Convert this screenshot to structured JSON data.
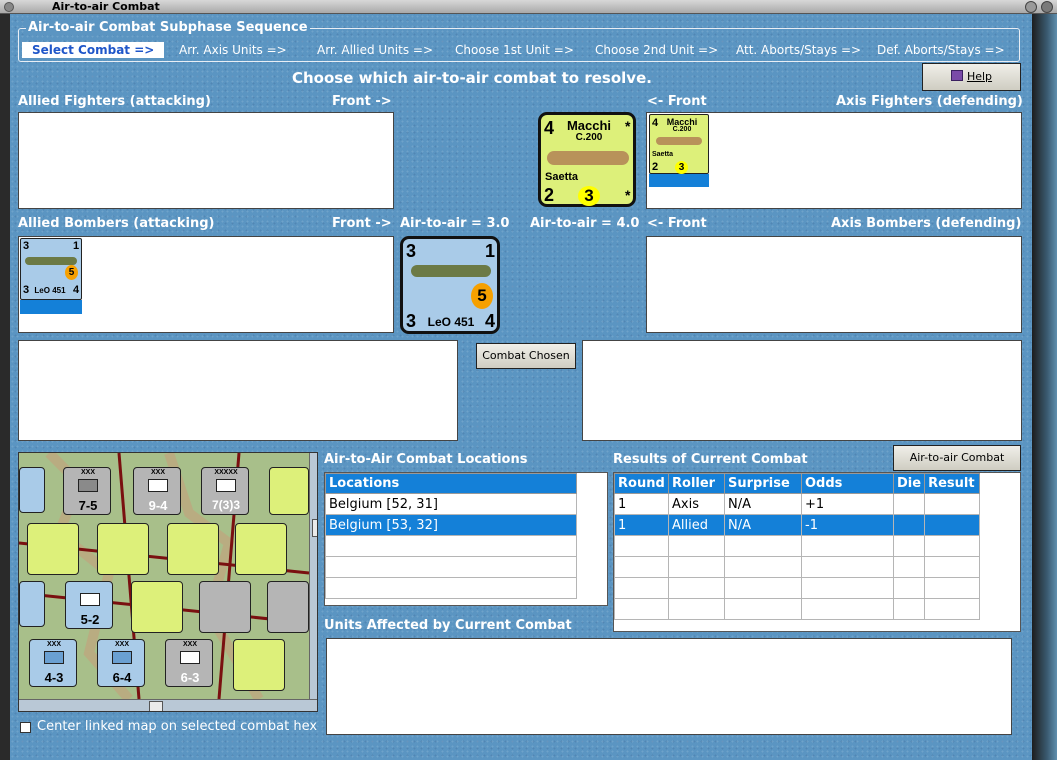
{
  "window": {
    "title": "Air-to-air Combat"
  },
  "sequence": {
    "title": "Air-to-air Combat Subphase Sequence",
    "steps": [
      "Select Combat =>",
      "Arr. Axis Units =>",
      "Arr. Allied Units =>",
      "Choose 1st Unit =>",
      "Choose 2nd Unit =>",
      "Att. Aborts/Stays =>",
      "Def. Aborts/Stays =>"
    ]
  },
  "instruction": "Choose which air-to-air combat to resolve.",
  "help_label": "Help",
  "headings": {
    "allied_fighters": "Allied Fighters (attacking)",
    "front_right_1": "Front ->",
    "front_left_1": "<- Front",
    "axis_fighters": "Axis Fighters (defending)",
    "allied_bombers": "Allied Bombers (attacking)",
    "front_right_2": "Front ->",
    "air_to_air_allied": "Air-to-air = 3.0",
    "air_to_air_axis": "Air-to-air = 4.0",
    "front_left_2": "<- Front",
    "axis_bombers": "Axis Bombers (defending)"
  },
  "combat_chosen_label": "Combat Chosen",
  "locations": {
    "title": "Air-to-Air Combat Locations",
    "header": "Locations",
    "rows": [
      "Belgium [52, 31]",
      "Belgium [53, 32]"
    ],
    "selected_index": 1
  },
  "results": {
    "title": "Results of Current Combat",
    "chart_button": "Air-to-air Combat Chart",
    "headers": [
      "Round",
      "Roller",
      "Surprise",
      "Odds",
      "Die",
      "Result"
    ],
    "rows": [
      [
        "1",
        "Axis",
        "N/A",
        "+1",
        "",
        ""
      ],
      [
        "1",
        "Allied",
        "N/A",
        "-1",
        "",
        ""
      ]
    ],
    "selected_index": 1
  },
  "units_affected_title": "Units Affected by Current Combat",
  "center_map_label": "Center linked map on selected combat hex",
  "units": {
    "macchi": {
      "top_left": "4",
      "name": "Macchi",
      "model": "C.200",
      "star": "*",
      "nickname": "Saetta",
      "bottom_left": "2",
      "value": "3"
    },
    "leo": {
      "top_left": "3",
      "top_right": "1",
      "value": "5",
      "bottom_left": "3",
      "name": "LeO 451",
      "bottom_right": "4"
    }
  },
  "map_counters": [
    {
      "label": "7-5",
      "top": "XXX"
    },
    {
      "label": "9-4",
      "top": "XXX"
    },
    {
      "label": "7(3)3",
      "top": "XXXXX"
    },
    {
      "label": "5-2",
      "top": "XXX"
    },
    {
      "label": "4-3",
      "top": "XXX"
    },
    {
      "label": "6-4",
      "top": "XXX"
    },
    {
      "label": "6-3",
      "top": "XXX"
    }
  ],
  "colors": {
    "panel": "#5b95c2",
    "selection": "#1480d8",
    "counter_yellow": "#ddf07a",
    "counter_blue": "#a9cbe8"
  }
}
